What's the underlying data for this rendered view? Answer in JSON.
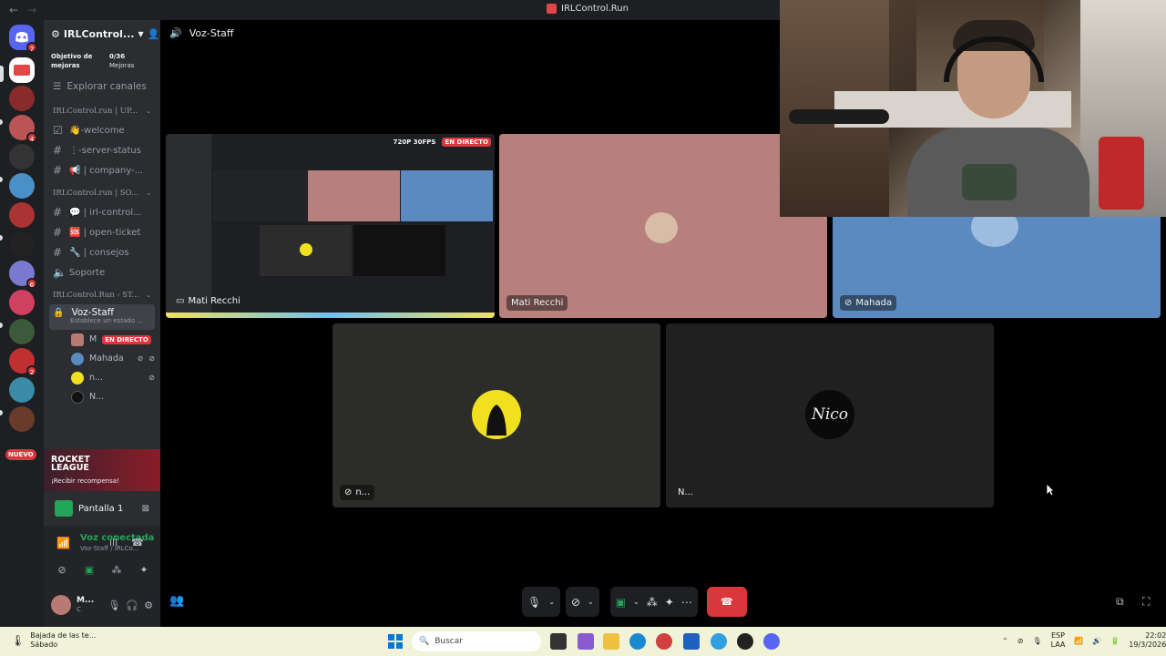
{
  "window": {
    "title": "IRLControl.Run"
  },
  "server": {
    "name": "IRLControl...",
    "goal_label": "Objetivo de mejoras",
    "boost_count": "0/36",
    "boost_label": "Mejoras"
  },
  "sidebar": {
    "explore": "Explorar canales",
    "categories": [
      {
        "name": "IRLControl.run | UP...",
        "channels": [
          {
            "icon": "rules-icon",
            "label": "👋-welcome"
          },
          {
            "icon": "hash-icon",
            "label": "⋮-server-status"
          },
          {
            "icon": "hash-icon",
            "label": "📢 | company-..."
          }
        ]
      },
      {
        "name": "IRLControl.run | SO...",
        "channels": [
          {
            "icon": "hash-icon",
            "label": "💬 | irl-control..."
          },
          {
            "icon": "hash-icon",
            "label": "🆘 | open-ticket"
          },
          {
            "icon": "hash-icon",
            "label": "🔧 | consejos"
          },
          {
            "icon": "voice-icon",
            "label": "Soporte"
          }
        ]
      },
      {
        "name": "IRLControl.Run - ST..."
      }
    ],
    "voice_channel": {
      "name": "Voz-Staff",
      "status": "Establece un estado ..."
    },
    "voice_users": [
      {
        "name": "M",
        "badge": "EN DIRECTO"
      },
      {
        "name": "Mahada"
      },
      {
        "name": "n..."
      },
      {
        "name": "N..."
      }
    ],
    "nuevo": "NUEVO",
    "rail_badges": [
      "7",
      "4",
      "6",
      "2"
    ],
    "promo": {
      "title_line1": "ROCKET",
      "title_line2": "LEAGUE",
      "subtitle": "¡Recibir recompensa!"
    },
    "screen_share": "Pantalla 1",
    "voice_status": "Voz conectada",
    "voice_where": "Voz-Staff / IRLCo...",
    "user": {
      "name": "M...",
      "tag": "C"
    }
  },
  "main": {
    "channel": "Voz-Staff",
    "stream": {
      "quality": "720P 30FPS",
      "live": "EN DIRECTO"
    },
    "tiles": [
      {
        "label": "Mati Recchi"
      },
      {
        "label": "Mati Recchi"
      },
      {
        "label": "Mahada"
      },
      {
        "label": "n..."
      },
      {
        "label": "N..."
      }
    ],
    "nico_logo": "Nico"
  },
  "taskbar": {
    "news_line1": "Bajada de las te...",
    "news_line2": "Sábado",
    "search_placeholder": "Buscar",
    "lang1": "ESP",
    "lang2": "LAA",
    "time": "22:02",
    "date": "19/3/2026"
  },
  "colors": {
    "accent_red": "#da373c",
    "green": "#23a55a",
    "pink_tile": "#b7807c",
    "blue_tile": "#5b8ac1"
  }
}
